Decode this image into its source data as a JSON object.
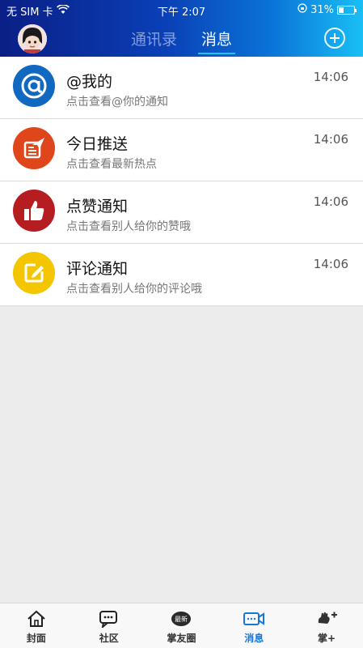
{
  "status_bar": {
    "carrier": "无 SIM 卡",
    "time": "下午 2:07",
    "battery": "31%"
  },
  "header": {
    "tabs": [
      {
        "label": "通讯录",
        "active": false
      },
      {
        "label": "消息",
        "active": true
      }
    ]
  },
  "messages": [
    {
      "title": "@我的",
      "subtitle": "点击查看@你的通知",
      "time": "14:06",
      "icon": "at-icon",
      "color": "#1168c0"
    },
    {
      "title": "今日推送",
      "subtitle": "点击查看最新热点",
      "time": "14:06",
      "icon": "paper-plane-icon",
      "color": "#e0461c"
    },
    {
      "title": "点赞通知",
      "subtitle": "点击查看别人给你的赞哦",
      "time": "14:06",
      "icon": "thumbs-up-icon",
      "color": "#b51d20"
    },
    {
      "title": "评论通知",
      "subtitle": "点击查看别人给你的评论哦",
      "time": "14:06",
      "icon": "edit-icon",
      "color": "#f3c600"
    }
  ],
  "tabbar": [
    {
      "label": "封面",
      "icon": "home-icon",
      "active": false
    },
    {
      "label": "社区",
      "icon": "chat-icon",
      "active": false
    },
    {
      "label": "掌友圈",
      "icon": "circle-logo-icon",
      "active": false
    },
    {
      "label": "消息",
      "icon": "video-message-icon",
      "active": true
    },
    {
      "label": "掌+",
      "icon": "hand-plus-icon",
      "active": false
    }
  ],
  "tabbar_logo_text": "最新"
}
